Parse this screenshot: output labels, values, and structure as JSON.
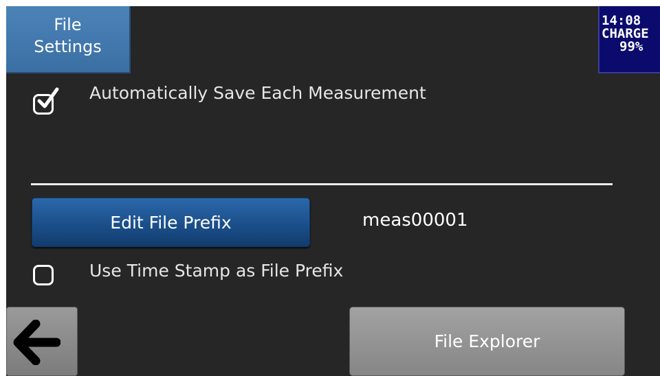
{
  "header": {
    "title_line1": "File",
    "title_line2": "Settings"
  },
  "status": {
    "time": "14:08",
    "charge_label": "CHARGE",
    "battery": "99%"
  },
  "options": {
    "auto_save": {
      "label": "Automatically Save Each Measurement",
      "checked": true
    },
    "timestamp_prefix": {
      "label": "Use Time Stamp as File Prefix",
      "checked": false
    }
  },
  "prefix": {
    "button_label": "Edit File Prefix",
    "value": "meas00001"
  },
  "footer": {
    "back_icon": "arrow-left-icon",
    "file_explorer_label": "File Explorer"
  },
  "colors": {
    "title_tab": "#4b83b8",
    "status_bg": "#0b0b6e",
    "primary_button": "#1b4f8a",
    "secondary_button": "#8f8f8f",
    "background": "#262626"
  }
}
